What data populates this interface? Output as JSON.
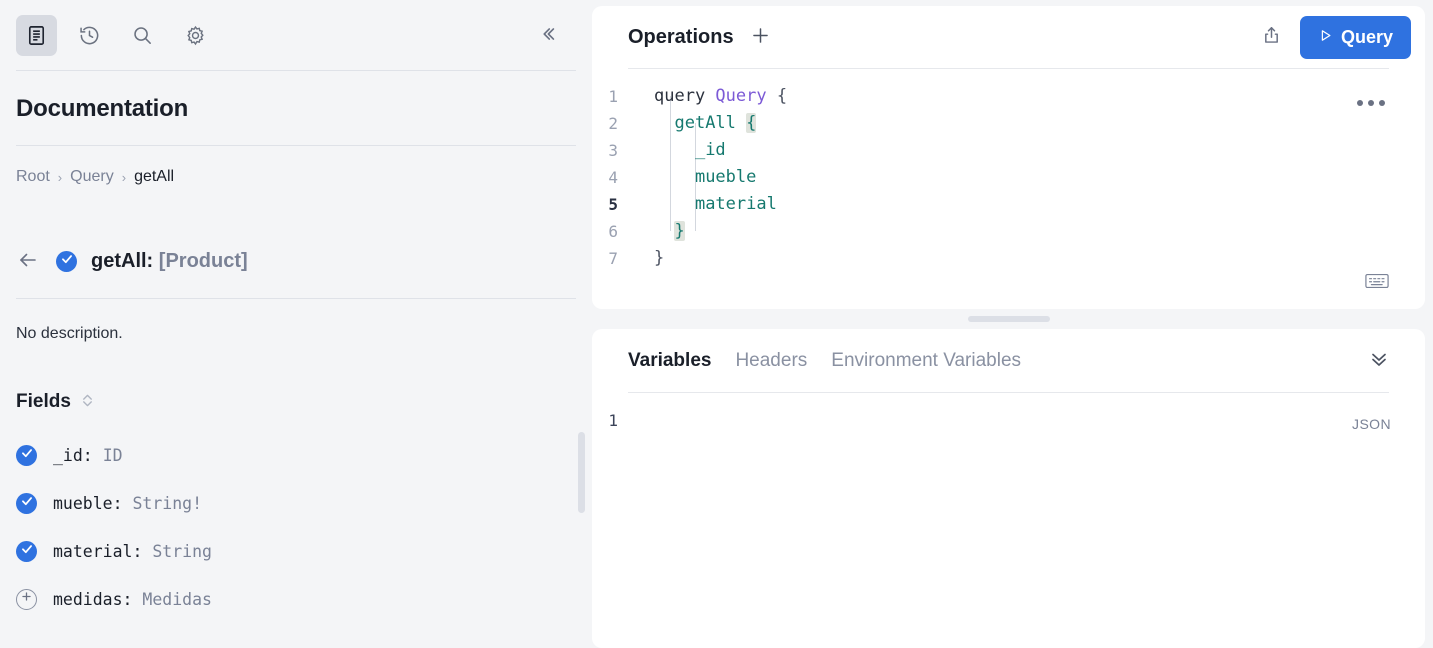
{
  "sidebar": {
    "tools": [
      {
        "name": "docs-icon",
        "label": "Documentation Explorer",
        "active": true
      },
      {
        "name": "history-icon",
        "label": "History",
        "active": false
      },
      {
        "name": "search-icon",
        "label": "Search",
        "active": false
      },
      {
        "name": "settings-icon",
        "label": "Settings",
        "active": false
      }
    ],
    "collapse_label": "Collapse sidebar",
    "title": "Documentation",
    "breadcrumb": [
      {
        "label": "Root",
        "current": false
      },
      {
        "label": "Query",
        "current": false
      },
      {
        "label": "getAll",
        "current": true
      }
    ],
    "breadcrumb_separator": "›",
    "back_label": "Back",
    "field_name": "getAll:",
    "field_return_type": "[Product]",
    "description": "No description.",
    "fields_heading": "Fields",
    "sort_label": "Sort fields",
    "fields": [
      {
        "name": "_id:",
        "type": "ID",
        "selected": true
      },
      {
        "name": "mueble:",
        "type": "String!",
        "selected": true
      },
      {
        "name": "material:",
        "type": "String",
        "selected": true
      },
      {
        "name": "medidas:",
        "type": "Medidas",
        "selected": false
      }
    ]
  },
  "operations": {
    "title": "Operations",
    "add_label": "+",
    "share_label": "Share",
    "run_label": "Query",
    "more_label": "More options",
    "keyboard_label": "Keyboard shortcuts",
    "active_line": 5,
    "lines": [
      {
        "n": "1",
        "segments": [
          {
            "text": "query ",
            "kind": "kw"
          },
          {
            "text": "Query",
            "kind": "op"
          },
          {
            "text": " {",
            "kind": "punct"
          }
        ]
      },
      {
        "n": "2",
        "segments": [
          {
            "text": "  ",
            "kind": "punct"
          },
          {
            "text": "getAll ",
            "kind": "field"
          },
          {
            "text": "{",
            "kind": "bracket"
          }
        ]
      },
      {
        "n": "3",
        "segments": [
          {
            "text": "    ",
            "kind": "punct"
          },
          {
            "text": "_id",
            "kind": "field"
          }
        ]
      },
      {
        "n": "4",
        "segments": [
          {
            "text": "    ",
            "kind": "punct"
          },
          {
            "text": "mueble",
            "kind": "field"
          }
        ]
      },
      {
        "n": "5",
        "segments": [
          {
            "text": "    ",
            "kind": "punct"
          },
          {
            "text": "material",
            "kind": "field"
          }
        ]
      },
      {
        "n": "6",
        "segments": [
          {
            "text": "  ",
            "kind": "punct"
          },
          {
            "text": "}",
            "kind": "bracket"
          }
        ]
      },
      {
        "n": "7",
        "segments": [
          {
            "text": "}",
            "kind": "punct"
          }
        ]
      }
    ]
  },
  "variables": {
    "tabs": [
      {
        "label": "Variables",
        "active": true
      },
      {
        "label": "Headers",
        "active": false
      },
      {
        "label": "Environment Variables",
        "active": false
      }
    ],
    "collapse_label": "Collapse panel",
    "line_number": "1",
    "format_badge": "JSON",
    "content": ""
  },
  "colors": {
    "accent": "#2f72e0",
    "sidebar_bg": "#f4f5f7",
    "panel_bg": "#ffffff",
    "text": "#1a1f29",
    "muted": "#7a8296",
    "token_operation": "#7c5ad6",
    "token_field": "#16796f"
  }
}
